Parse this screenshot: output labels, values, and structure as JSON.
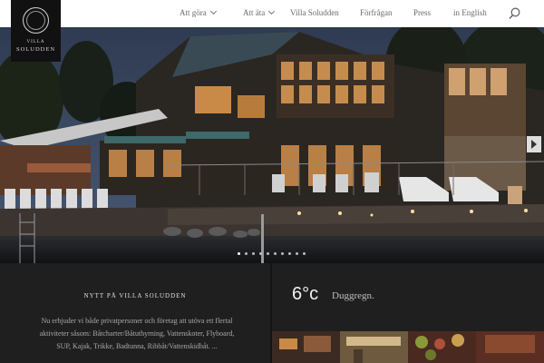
{
  "brand": {
    "line1": "VILLA",
    "line2": "SOLUDDEN"
  },
  "nav": {
    "items": [
      {
        "label": "Att göra",
        "dropdown": true
      },
      {
        "label": "Att äta",
        "dropdown": true
      },
      {
        "label": "Villa Soludden",
        "dropdown": false
      },
      {
        "label": "Förfrågan",
        "dropdown": false
      },
      {
        "label": "Press",
        "dropdown": false
      },
      {
        "label": "in English",
        "dropdown": false
      }
    ],
    "search_icon": "search-icon"
  },
  "slider": {
    "total_slides": 10,
    "active_slide": 1,
    "next_icon": "play-arrow-icon"
  },
  "news": {
    "title": "NYTT PÅ VILLA SOLUDDEN",
    "text": "Nu erbjuder vi både privatpersoner och företag att utöva ett flertal aktiviteter såsom: Båtcharter/Båtuthyrning, Vattenskoter, Flyboard, SUP, Kajak, Trikke, Badtunna, Ribbåt/Vattenskidbåt.   ..."
  },
  "weather": {
    "temperature": "6°c",
    "condition": "Duggregn."
  },
  "colors": {
    "header_bg": "#ffffff",
    "logo_bg": "#111111",
    "panel_bg": "#1f1f1f",
    "nav_text": "#6a6a6a"
  }
}
